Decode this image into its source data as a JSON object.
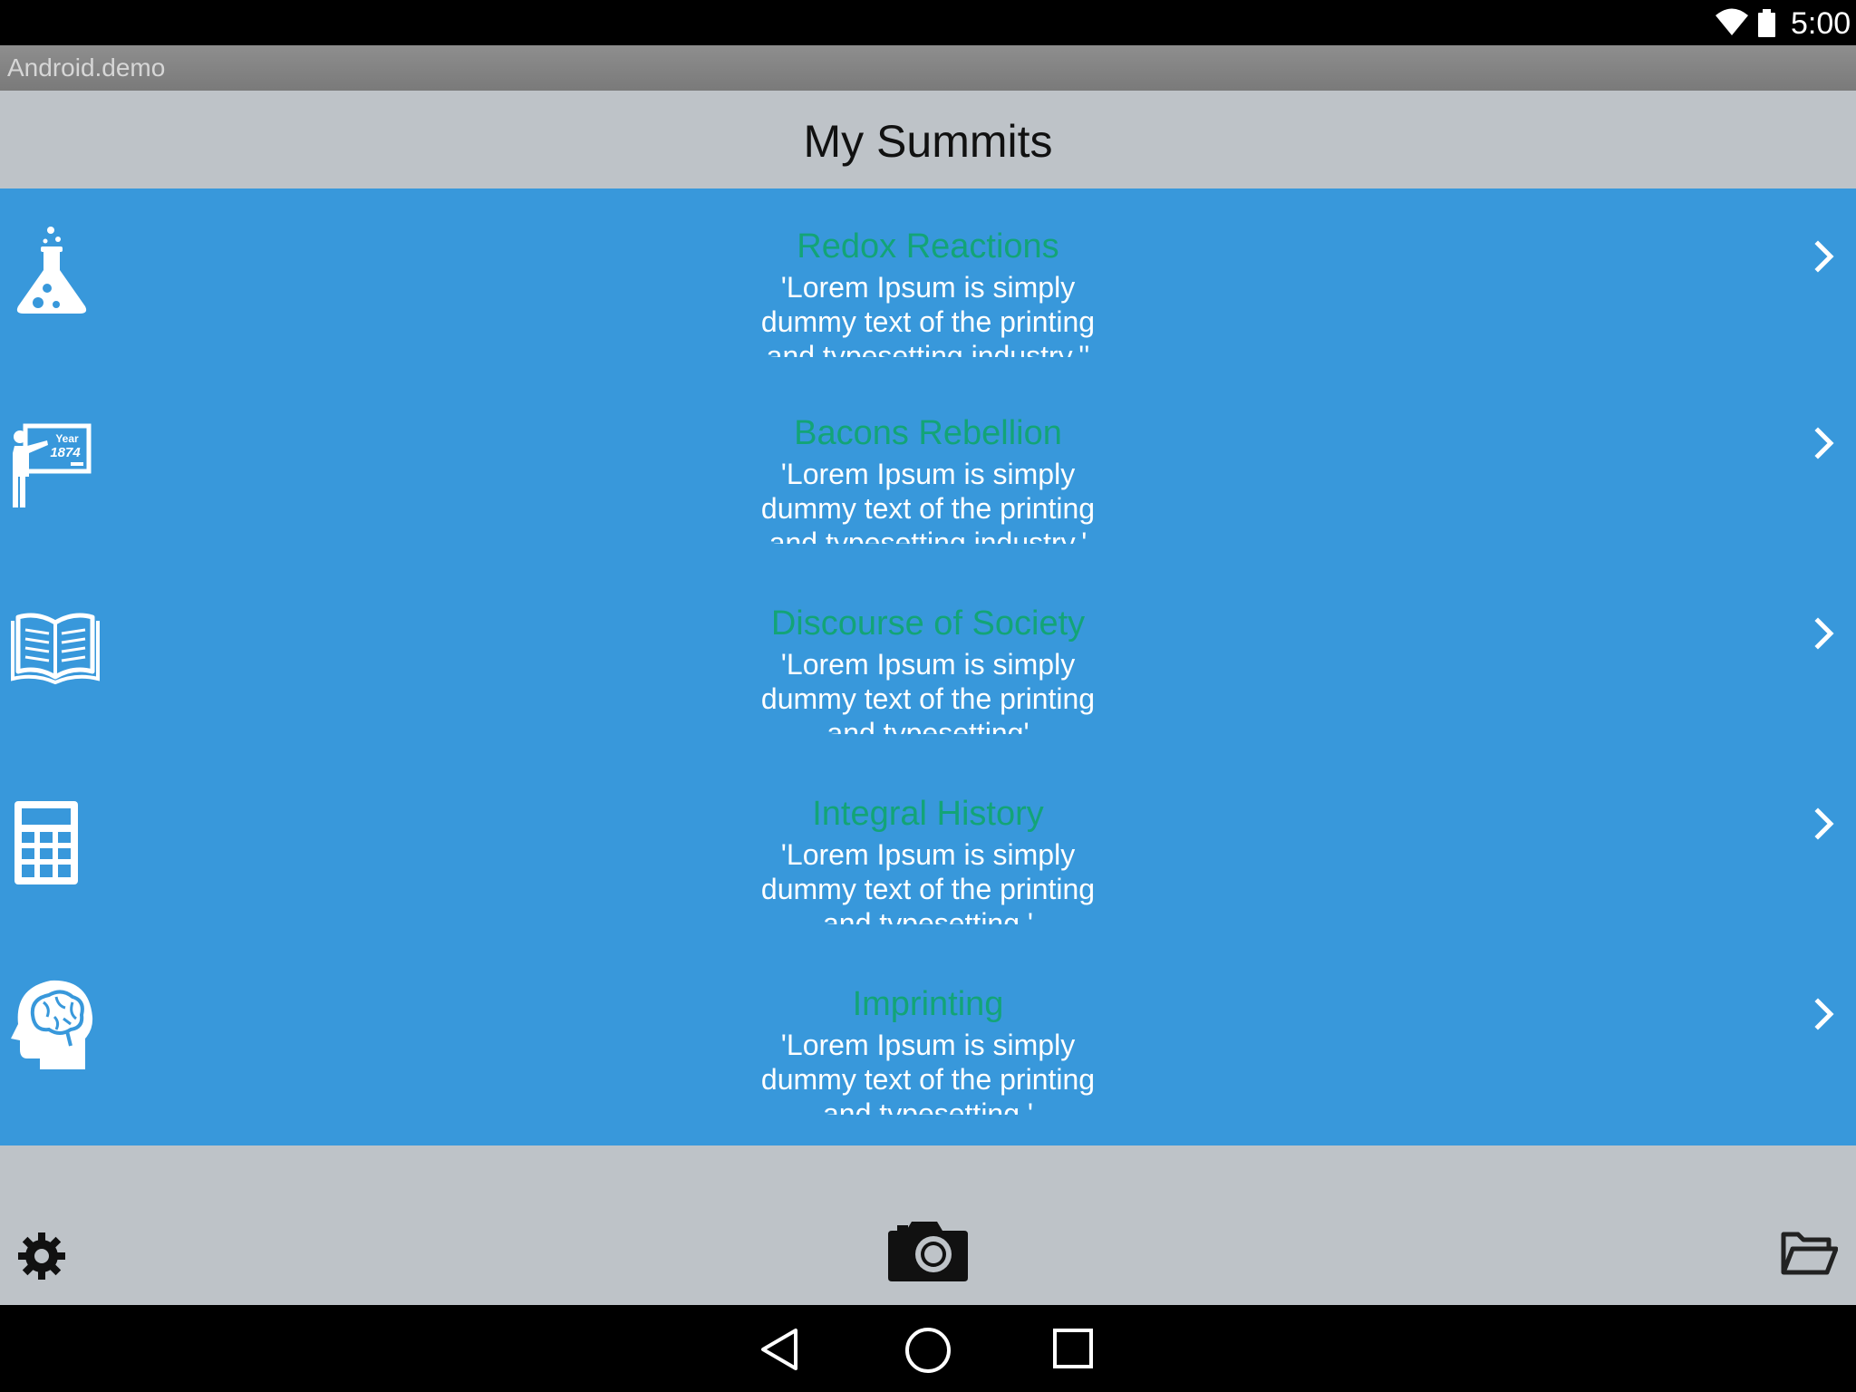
{
  "status_bar": {
    "time": "5:00",
    "icons": [
      "wifi-icon",
      "battery-icon"
    ]
  },
  "app_bar": {
    "app_name": "Android.demo"
  },
  "header": {
    "title": "My Summits"
  },
  "summits": [
    {
      "title": "Redox Reactions",
      "description": "'Lorem Ipsum is simply dummy text of the printing and typesetting industry.''",
      "icon": "flask-icon"
    },
    {
      "title": "Bacons Rebellion",
      "description": "'Lorem Ipsum is simply dummy text of the printing and typesetting industry.'",
      "icon": "teacher-board-icon"
    },
    {
      "title": "Discourse of Society",
      "description": "'Lorem Ipsum is simply dummy text of the printing and typesetting'",
      "icon": "open-book-icon"
    },
    {
      "title": "Integral History",
      "description": "'Lorem Ipsum is simply dummy text of the printing and typesetting.'",
      "icon": "calculator-icon"
    },
    {
      "title": "Imprinting",
      "description": "'Lorem Ipsum is simply dummy text of the printing and typesetting.'",
      "icon": "brain-head-icon"
    }
  ],
  "toolbar": {
    "left_icon": "gear-icon",
    "center_icon": "camera-icon",
    "right_icon": "folder-icon"
  },
  "nav_bar": {
    "icons": [
      "back-icon",
      "home-icon",
      "recents-icon"
    ]
  },
  "colors": {
    "list_background": "#3898db",
    "title_green": "#13a477",
    "header_gray": "#bec3c8"
  }
}
